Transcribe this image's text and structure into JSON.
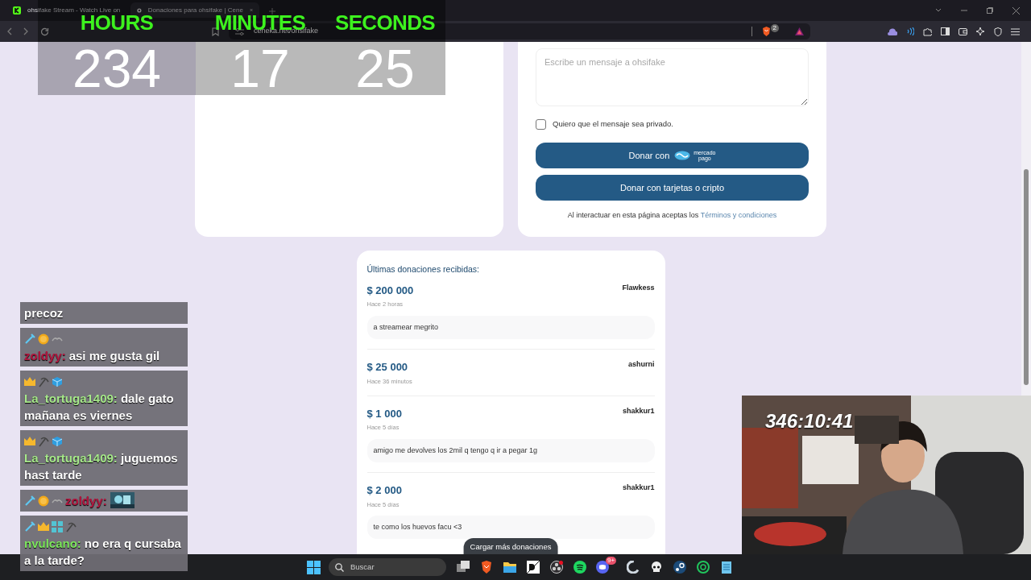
{
  "browser": {
    "tabs": [
      {
        "title": "ohsifake Stream - Watch Live on",
        "selected": false
      },
      {
        "title": "Donaciones para ohsifake | Cene",
        "selected": true
      }
    ],
    "url": "ceneka.net/ohsifake",
    "shield_badge": "2"
  },
  "timer_overlay": {
    "units": [
      {
        "label": "HOURS",
        "value": "234"
      },
      {
        "label": "MINUTES",
        "value": "17"
      },
      {
        "label": "SECONDS",
        "value": "25"
      }
    ]
  },
  "donation_form": {
    "message_placeholder": "Escribe un mensaje a ohsifake",
    "private_checkbox": {
      "label": "Quiero que el mensaje sea privado.",
      "checked": false
    },
    "buttons": [
      {
        "kind": "mercadopago",
        "label": "Donar con",
        "logo_text": [
          "mercado",
          "pago"
        ]
      },
      {
        "kind": "plain",
        "label": "Donar con tarjetas o cripto"
      }
    ],
    "terms": {
      "text": "Al interactuar en esta página aceptas los",
      "link": "Términos y condiciones"
    }
  },
  "recent_donations": {
    "title": "Últimas donaciones recibidas:",
    "items": [
      {
        "amount": "$ 200 000",
        "donor": "Flawkess",
        "time": "Hace 2 horas",
        "message": "a streamear megrito"
      },
      {
        "amount": "$ 25 000",
        "donor": "ashurni",
        "time": "Hace 36 minutos"
      },
      {
        "amount": "$ 1 000",
        "donor": "shakkur1",
        "time": "Hace 5 días",
        "message": "amigo me devolves los 2mil q tengo q ir a pegar 1g"
      },
      {
        "amount": "$ 2 000",
        "donor": "shakkur1",
        "time": "Hace 5 días",
        "message": "te como los huevos facu <3"
      }
    ],
    "load_more": "Cargar más donaciones"
  },
  "chat": {
    "messages": [
      {
        "text": "precoz"
      },
      {
        "badges": [
          {
            "kind": "sword"
          },
          {
            "kind": "coin"
          },
          {
            "kind": "mustache"
          }
        ],
        "user": "zoldyy:",
        "color": "#b3163f",
        "text": "asi me gusta gil"
      },
      {
        "badges": [
          {
            "kind": "crown"
          },
          {
            "kind": "pickaxe"
          },
          {
            "kind": "cube"
          }
        ],
        "user": "La_tortuga1409:",
        "color": "#a6e88a",
        "text": "dale gato mañana es viernes"
      },
      {
        "badges": [
          {
            "kind": "crown"
          },
          {
            "kind": "pickaxe"
          },
          {
            "kind": "cube"
          }
        ],
        "user": "La_tortuga1409:",
        "color": "#a6e88a",
        "text": "juguemos hast tarde"
      },
      {
        "badges": [
          {
            "kind": "sword"
          },
          {
            "kind": "coin"
          },
          {
            "kind": "mustache"
          }
        ],
        "user": "zoldyy:",
        "color": "#b3163f",
        "emote": true
      },
      {
        "badges": [
          {
            "kind": "sword"
          },
          {
            "kind": "crown"
          },
          {
            "kind": "grid"
          },
          {
            "kind": "pickaxe"
          }
        ],
        "user": "nvulcano:",
        "color": "#7ee85e",
        "text": "no era q cursaba a la tarde?"
      }
    ]
  },
  "webcam": {
    "kind": "picture",
    "stream_timer": "346:10:41"
  },
  "taskbar": {
    "search_placeholder": "Buscar",
    "discord_badge": "9+"
  }
}
